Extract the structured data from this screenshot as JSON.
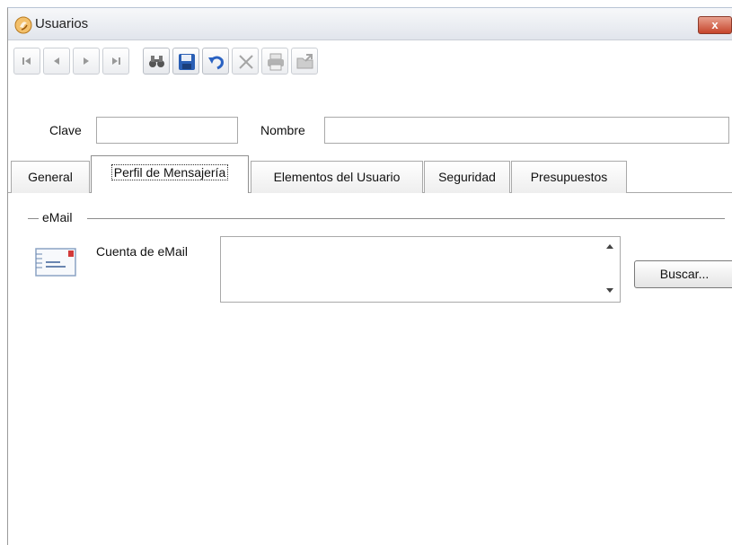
{
  "window": {
    "title": "Usuarios",
    "close_label": "x"
  },
  "toolbar": {
    "buttons": [
      {
        "name": "first-record-button",
        "icon": "first-icon"
      },
      {
        "name": "previous-record-button",
        "icon": "previous-icon"
      },
      {
        "name": "next-record-button",
        "icon": "next-icon"
      },
      {
        "name": "last-record-button",
        "icon": "last-icon"
      },
      {
        "name": "find-button",
        "icon": "binoculars-icon"
      },
      {
        "name": "save-button",
        "icon": "floppy-disk-icon"
      },
      {
        "name": "undo-button",
        "icon": "undo-icon"
      },
      {
        "name": "delete-button",
        "icon": "x-delete-icon"
      },
      {
        "name": "print-button",
        "icon": "printer-icon"
      },
      {
        "name": "export-button",
        "icon": "folder-export-icon"
      }
    ]
  },
  "form": {
    "clave_label": "Clave",
    "clave_value": "",
    "nombre_label": "Nombre",
    "nombre_value": ""
  },
  "tabs": [
    {
      "label": "General",
      "active": false
    },
    {
      "label": "Perfil de Mensajería",
      "active": true
    },
    {
      "label": "Elementos del Usuario",
      "active": false
    },
    {
      "label": "Seguridad",
      "active": false
    },
    {
      "label": "Presupuestos",
      "active": false
    }
  ],
  "email_section": {
    "legend": "eMail",
    "account_label": "Cuenta de eMail",
    "account_value": "",
    "browse_label": "Buscar...",
    "icon": "envelope-icon"
  },
  "colors": {
    "close_button": "#c6452b",
    "border": "#a9a9a9",
    "save_icon_blue": "#2a5fb5"
  }
}
